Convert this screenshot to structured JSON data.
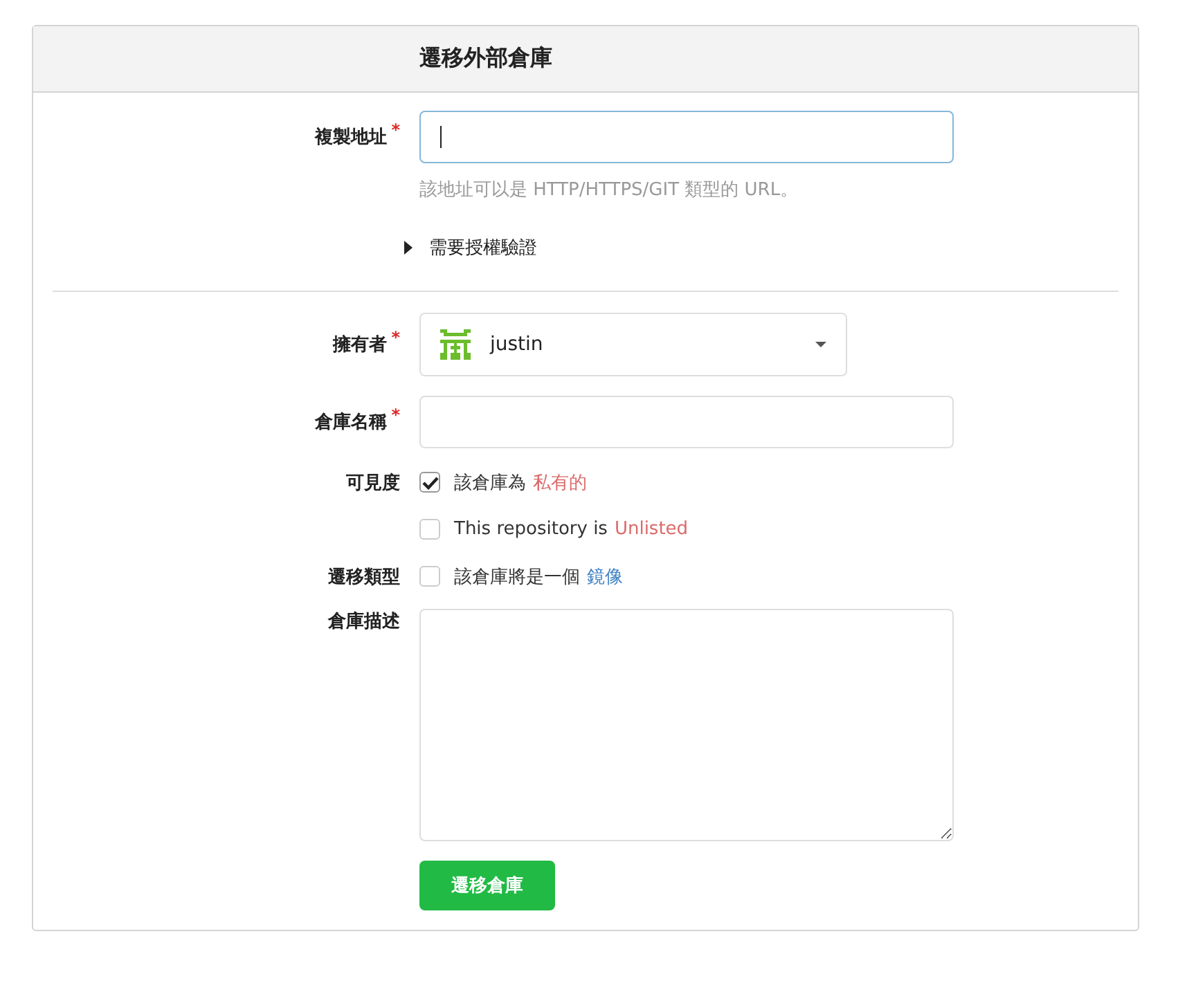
{
  "header": {
    "title": "遷移外部倉庫"
  },
  "clone_url": {
    "label": "複製地址",
    "required_mark": "*",
    "focused": true,
    "help": "該地址可以是 HTTP/HTTPS/GIT 類型的 URL。"
  },
  "auth_toggle": {
    "label": "需要授權驗證",
    "expanded": false
  },
  "owner": {
    "label": "擁有者",
    "required_mark": "*",
    "value": "justin"
  },
  "repo_name": {
    "label": "倉庫名稱",
    "required_mark": "*"
  },
  "options": [
    {
      "label": "可見度",
      "text": "該倉庫為",
      "emphasis": "私有的",
      "kind": "warning",
      "checked": true
    },
    {
      "text": "This repository is",
      "emphasis": "Unlisted",
      "kind": "warning",
      "checked": false
    },
    {
      "label": "遷移類型",
      "text": "該倉庫將是一個",
      "emphasis": "鏡像",
      "kind": "link",
      "checked": false
    }
  ],
  "description": {
    "label": "倉庫描述"
  },
  "submit": {
    "label": "遷移倉庫"
  }
}
